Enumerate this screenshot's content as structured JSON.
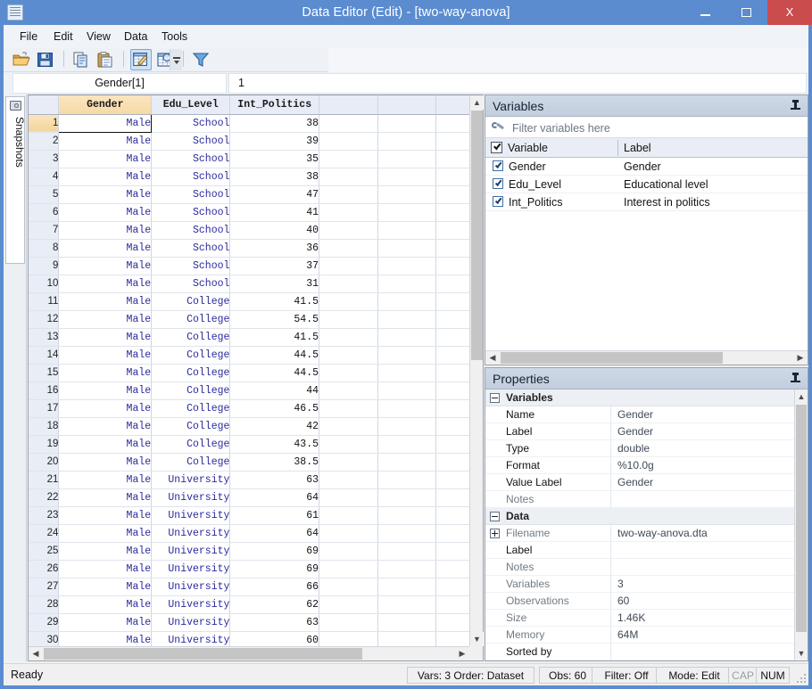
{
  "window": {
    "title": "Data Editor (Edit) - [two-way-anova]",
    "app_icon": "data-grid-icon",
    "minimize": "–",
    "maximize": "□",
    "close": "X"
  },
  "menu": {
    "items": [
      {
        "label": "File"
      },
      {
        "label": "Edit"
      },
      {
        "label": "View"
      },
      {
        "label": "Data"
      },
      {
        "label": "Tools"
      }
    ]
  },
  "toolbar": {
    "buttons": [
      {
        "name": "open-icon",
        "tooltip": "Open"
      },
      {
        "name": "save-icon",
        "tooltip": "Save"
      },
      {
        "name": "copy-icon",
        "tooltip": "Copy"
      },
      {
        "name": "paste-icon",
        "tooltip": "Paste"
      },
      {
        "name": "edit-mode-icon",
        "tooltip": "Edit mode",
        "selected": true
      },
      {
        "name": "browse-mode-icon",
        "tooltip": "Browse mode"
      },
      {
        "name": "filter-icon",
        "tooltip": "Filter observations"
      }
    ],
    "overflow": "toolbar-overflow-icon"
  },
  "cell_reference": {
    "name": "Gender[1]",
    "value": "1"
  },
  "snapshots_tab": {
    "label": "Snapshots",
    "icon": "camera-icon"
  },
  "grid": {
    "columns": [
      "Gender",
      "Edu_Level",
      "Int_Politics",
      "",
      "",
      ""
    ],
    "active_column": "Gender",
    "selected_cell": {
      "row": 1,
      "column": "Gender"
    },
    "rows": [
      {
        "n": "1",
        "Gender": "Male",
        "Edu_Level": "School",
        "Int_Politics": "38"
      },
      {
        "n": "2",
        "Gender": "Male",
        "Edu_Level": "School",
        "Int_Politics": "39"
      },
      {
        "n": "3",
        "Gender": "Male",
        "Edu_Level": "School",
        "Int_Politics": "35"
      },
      {
        "n": "4",
        "Gender": "Male",
        "Edu_Level": "School",
        "Int_Politics": "38"
      },
      {
        "n": "5",
        "Gender": "Male",
        "Edu_Level": "School",
        "Int_Politics": "47"
      },
      {
        "n": "6",
        "Gender": "Male",
        "Edu_Level": "School",
        "Int_Politics": "41"
      },
      {
        "n": "7",
        "Gender": "Male",
        "Edu_Level": "School",
        "Int_Politics": "40"
      },
      {
        "n": "8",
        "Gender": "Male",
        "Edu_Level": "School",
        "Int_Politics": "36"
      },
      {
        "n": "9",
        "Gender": "Male",
        "Edu_Level": "School",
        "Int_Politics": "37"
      },
      {
        "n": "10",
        "Gender": "Male",
        "Edu_Level": "School",
        "Int_Politics": "31"
      },
      {
        "n": "11",
        "Gender": "Male",
        "Edu_Level": "College",
        "Int_Politics": "41.5"
      },
      {
        "n": "12",
        "Gender": "Male",
        "Edu_Level": "College",
        "Int_Politics": "54.5"
      },
      {
        "n": "13",
        "Gender": "Male",
        "Edu_Level": "College",
        "Int_Politics": "41.5"
      },
      {
        "n": "14",
        "Gender": "Male",
        "Edu_Level": "College",
        "Int_Politics": "44.5"
      },
      {
        "n": "15",
        "Gender": "Male",
        "Edu_Level": "College",
        "Int_Politics": "44.5"
      },
      {
        "n": "16",
        "Gender": "Male",
        "Edu_Level": "College",
        "Int_Politics": "44"
      },
      {
        "n": "17",
        "Gender": "Male",
        "Edu_Level": "College",
        "Int_Politics": "46.5"
      },
      {
        "n": "18",
        "Gender": "Male",
        "Edu_Level": "College",
        "Int_Politics": "42"
      },
      {
        "n": "19",
        "Gender": "Male",
        "Edu_Level": "College",
        "Int_Politics": "43.5"
      },
      {
        "n": "20",
        "Gender": "Male",
        "Edu_Level": "College",
        "Int_Politics": "38.5"
      },
      {
        "n": "21",
        "Gender": "Male",
        "Edu_Level": "University",
        "Int_Politics": "63"
      },
      {
        "n": "22",
        "Gender": "Male",
        "Edu_Level": "University",
        "Int_Politics": "64"
      },
      {
        "n": "23",
        "Gender": "Male",
        "Edu_Level": "University",
        "Int_Politics": "61"
      },
      {
        "n": "24",
        "Gender": "Male",
        "Edu_Level": "University",
        "Int_Politics": "64"
      },
      {
        "n": "25",
        "Gender": "Male",
        "Edu_Level": "University",
        "Int_Politics": "69"
      },
      {
        "n": "26",
        "Gender": "Male",
        "Edu_Level": "University",
        "Int_Politics": "69"
      },
      {
        "n": "27",
        "Gender": "Male",
        "Edu_Level": "University",
        "Int_Politics": "66"
      },
      {
        "n": "28",
        "Gender": "Male",
        "Edu_Level": "University",
        "Int_Politics": "62"
      },
      {
        "n": "29",
        "Gender": "Male",
        "Edu_Level": "University",
        "Int_Politics": "63"
      },
      {
        "n": "30",
        "Gender": "Male",
        "Edu_Level": "University",
        "Int_Politics": "60"
      }
    ]
  },
  "variables_panel": {
    "title": "Variables",
    "filter_placeholder": "Filter variables here",
    "filter_value": "",
    "header": {
      "variable": "Variable",
      "label": "Label"
    },
    "rows": [
      {
        "checked": true,
        "name": "Gender",
        "label": "Gender"
      },
      {
        "checked": true,
        "name": "Edu_Level",
        "label": "Educational level"
      },
      {
        "checked": true,
        "name": "Int_Politics",
        "label": "Interest in politics"
      }
    ]
  },
  "properties_panel": {
    "title": "Properties",
    "groups": [
      {
        "name": "Variables",
        "rows": [
          {
            "key": "Name",
            "value": "Gender",
            "dim": false
          },
          {
            "key": "Label",
            "value": "Gender",
            "dim": false
          },
          {
            "key": "Type",
            "value": "double",
            "dim": false
          },
          {
            "key": "Format",
            "value": "%10.0g",
            "dim": false
          },
          {
            "key": "Value Label",
            "value": "Gender",
            "dim": false
          },
          {
            "key": "Notes",
            "value": "",
            "dim": true
          }
        ]
      },
      {
        "name": "Data",
        "rows": [
          {
            "key": "Filename",
            "value": "two-way-anova.dta",
            "dim": true,
            "expandable": true
          },
          {
            "key": "Label",
            "value": "",
            "dim": false
          },
          {
            "key": "Notes",
            "value": "",
            "dim": true
          },
          {
            "key": "Variables",
            "value": "3",
            "dim": true
          },
          {
            "key": "Observations",
            "value": "60",
            "dim": true
          },
          {
            "key": "Size",
            "value": "1.46K",
            "dim": true
          },
          {
            "key": "Memory",
            "value": "64M",
            "dim": true
          },
          {
            "key": "Sorted by",
            "value": "",
            "dim": false
          }
        ]
      }
    ]
  },
  "statusbar": {
    "ready": "Ready",
    "vars_order": "Vars: 3  Order: Dataset",
    "obs": "Obs: 60",
    "filter": "Filter: Off",
    "mode": "Mode: Edit",
    "cap": "CAP",
    "num": "NUM"
  }
}
